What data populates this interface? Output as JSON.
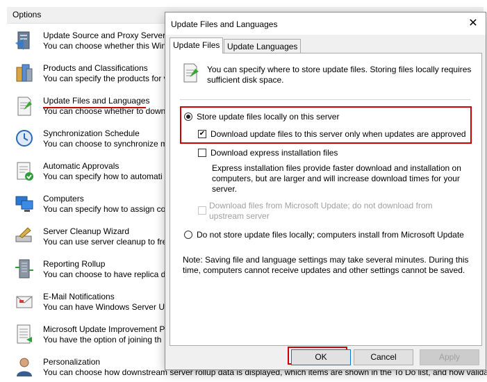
{
  "options": {
    "header": "Options",
    "items": [
      {
        "title": "Update Source and Proxy Server",
        "desc": "You can choose whether this Win",
        "icon": "server-proxy-icon"
      },
      {
        "title": "Products and Classifications",
        "desc": "You can specify the products for v",
        "icon": "products-icon"
      },
      {
        "title": "Update Files and Languages",
        "desc": "You can choose whether to down",
        "icon": "update-files-icon"
      },
      {
        "title": "Synchronization Schedule",
        "desc": "You can choose to synchronize m",
        "icon": "sync-schedule-icon"
      },
      {
        "title": "Automatic Approvals",
        "desc": "You can specify how to automati",
        "icon": "auto-approvals-icon"
      },
      {
        "title": "Computers",
        "desc": "You can specify how to assign co",
        "icon": "computers-icon"
      },
      {
        "title": "Server Cleanup Wizard",
        "desc": "You can use server cleanup to fre",
        "icon": "cleanup-wizard-icon"
      },
      {
        "title": "Reporting Rollup",
        "desc": "You can choose to have replica d",
        "icon": "reporting-rollup-icon"
      },
      {
        "title": "E-Mail Notifications",
        "desc": "You can have Windows Server Up",
        "icon": "email-icon"
      },
      {
        "title": "Microsoft Update Improvement P",
        "desc": "You have the option of joining th",
        "icon": "improvement-icon"
      },
      {
        "title": "Personalization",
        "desc": "You can choose how downstream server rollup data is displayed, which items are shown in the To Do list, and how validat",
        "icon": "person-icon"
      }
    ]
  },
  "dialog": {
    "title": "Update Files and Languages",
    "close": "✕",
    "tabs": [
      "Update Files",
      "Update Languages"
    ],
    "info": "You can specify where to store update files. Storing files locally requires sufficient disk space.",
    "radio_store_local": "Store update files locally on this server",
    "check_download_approved": "Download update files to this server only when updates are approved",
    "check_express": "Download express installation files",
    "express_desc": "Express installation files provide faster download and installation on computers, but are larger and will increase download times for your server.",
    "check_ms_update": "Download files from Microsoft Update; do not download from upstream server",
    "radio_not_local": "Do not store update files locally; computers install from Microsoft Update",
    "note": "Note: Saving file and language settings may take several minutes. During this time, computers cannot receive updates and other settings cannot be saved.",
    "buttons": {
      "ok": "OK",
      "cancel": "Cancel",
      "apply": "Apply"
    },
    "checkmark": "✔"
  },
  "colors": {
    "highlight": "#cc0000",
    "accent": "#0078d7"
  }
}
